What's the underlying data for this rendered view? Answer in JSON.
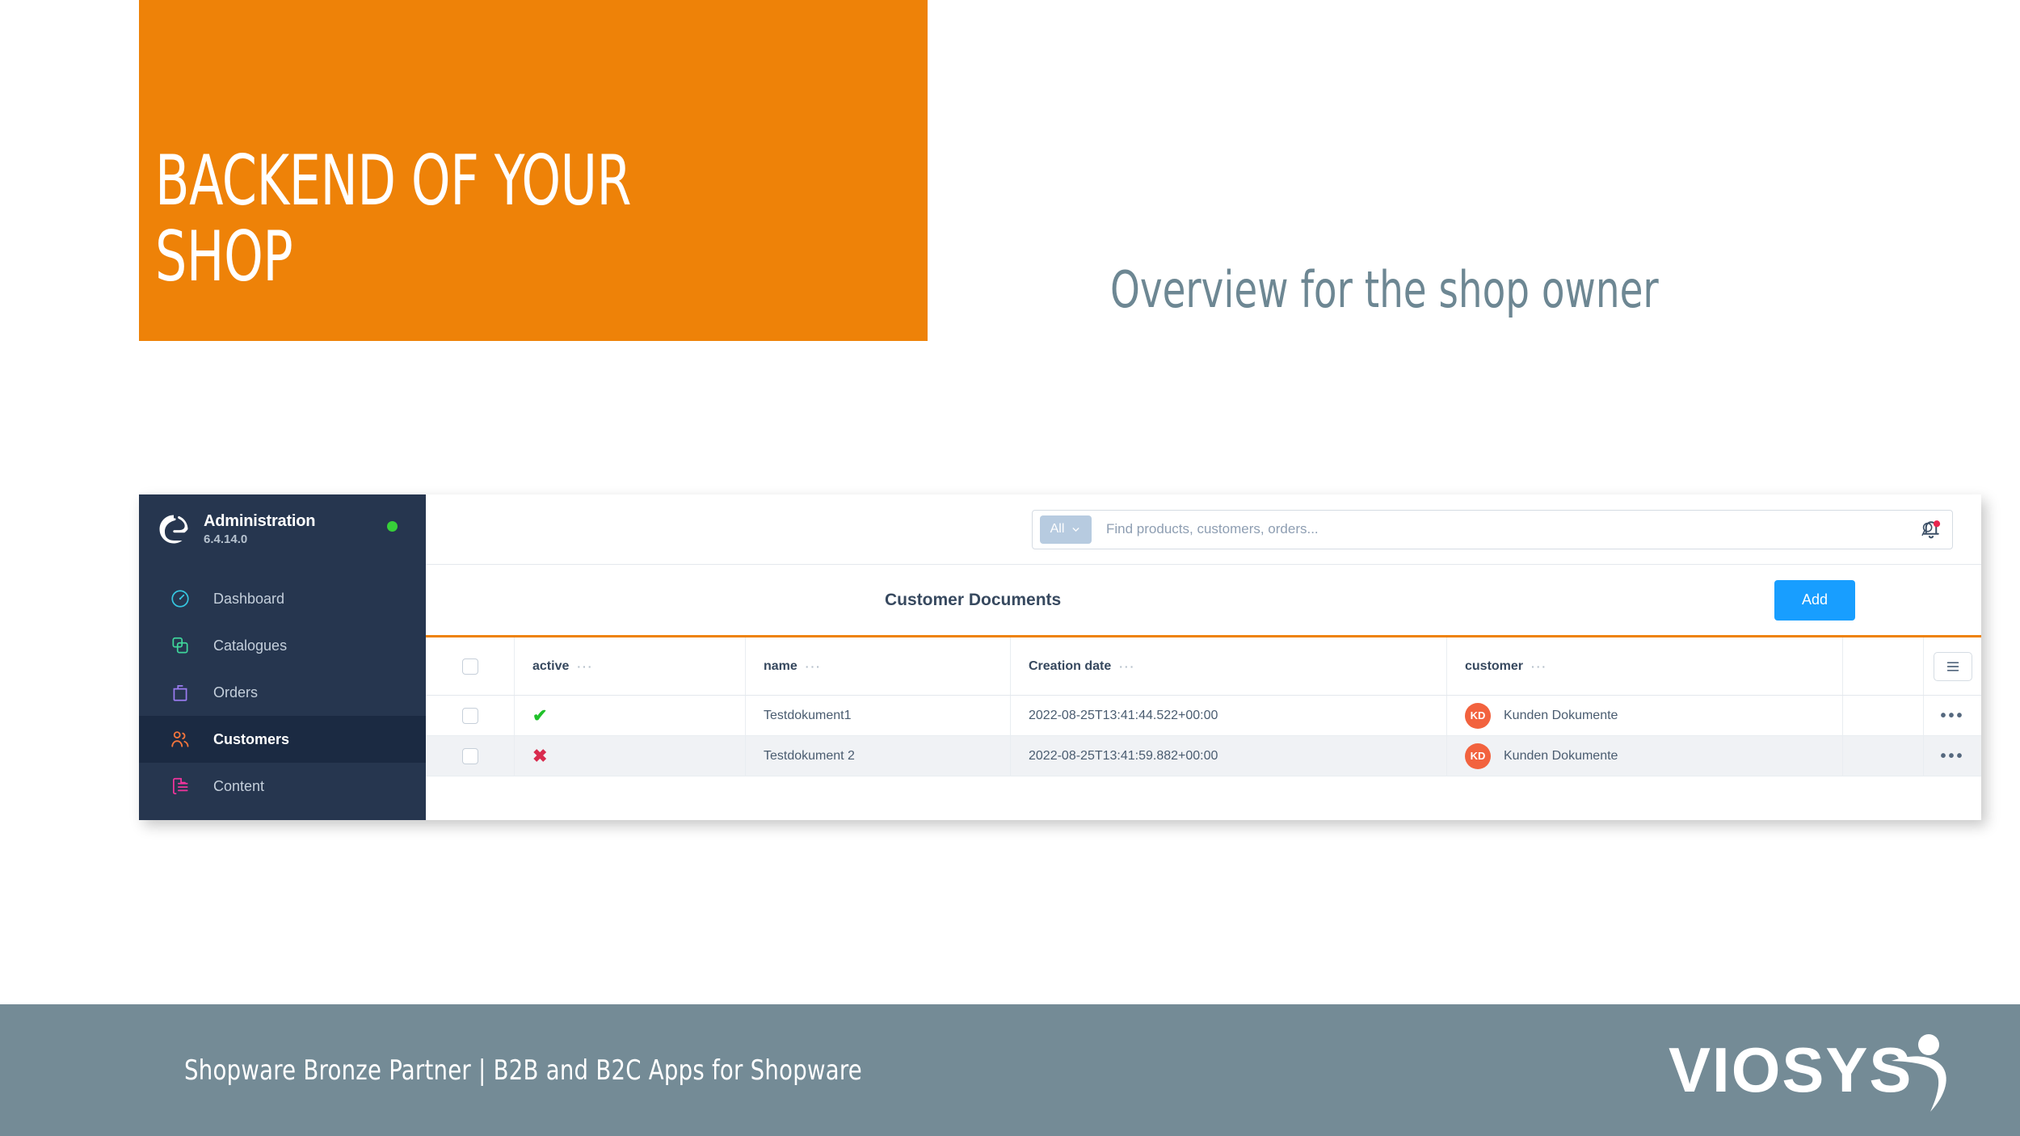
{
  "slide": {
    "title": "BACKEND OF YOUR\nSHOP",
    "subtitle": "Overview for the shop owner",
    "title_bg_color": "#ee8208",
    "subtitle_color": "#6d8793"
  },
  "admin": {
    "sidebar": {
      "app_name": "Administration",
      "version": "6.4.14.0",
      "status_color": "#37d039",
      "items": [
        {
          "label": "Dashboard",
          "icon": "dashboard-gauge-icon",
          "color": "#35c6e0",
          "active": false
        },
        {
          "label": "Catalogues",
          "icon": "catalogues-stack-icon",
          "color": "#3fd69b",
          "active": false
        },
        {
          "label": "Orders",
          "icon": "orders-bag-icon",
          "color": "#9a7bf0",
          "active": false
        },
        {
          "label": "Customers",
          "icon": "customers-people-icon",
          "color": "#f4753c",
          "active": true
        },
        {
          "label": "Content",
          "icon": "content-page-icon",
          "color": "#f0349c",
          "active": false
        }
      ]
    },
    "topbar": {
      "search_scope": "All",
      "search_placeholder": "Find products, customers, orders...",
      "search_value": "",
      "search_icon": "search-icon",
      "scope_chevron_icon": "chevron-down-icon",
      "notifications_icon": "bell-icon",
      "notifications_badge": true,
      "notifications_badge_color": "#e8264f"
    },
    "page": {
      "title": "Customer Documents",
      "add_label": "Add",
      "add_color": "#189eff",
      "accent_color": "#ee8208"
    },
    "grid": {
      "columns": [
        {
          "key": "checkbox",
          "label": ""
        },
        {
          "key": "active",
          "label": "active"
        },
        {
          "key": "name",
          "label": "name"
        },
        {
          "key": "date",
          "label": "Creation date"
        },
        {
          "key": "customer",
          "label": "customer"
        }
      ],
      "column_menu_glyph": "···",
      "settings_icon": "grid-settings-icon",
      "row_menu_glyph": "•••",
      "rows": [
        {
          "active": true,
          "active_glyph": "✔",
          "name": "Testdokument1",
          "date": "2022-08-25T13:41:44.522+00:00",
          "customer": "Kunden Dokumente",
          "customer_initials": "KD"
        },
        {
          "active": false,
          "active_glyph": "✖",
          "name": "Testdokument 2",
          "date": "2022-08-25T13:41:59.882+00:00",
          "customer": "Kunden Dokumente",
          "customer_initials": "KD"
        }
      ]
    }
  },
  "footer": {
    "text": "Shopware Bronze Partner  |  B2B and B2C Apps for Shopware",
    "brand": "VIOSYS",
    "bg_color": "#748b96"
  }
}
